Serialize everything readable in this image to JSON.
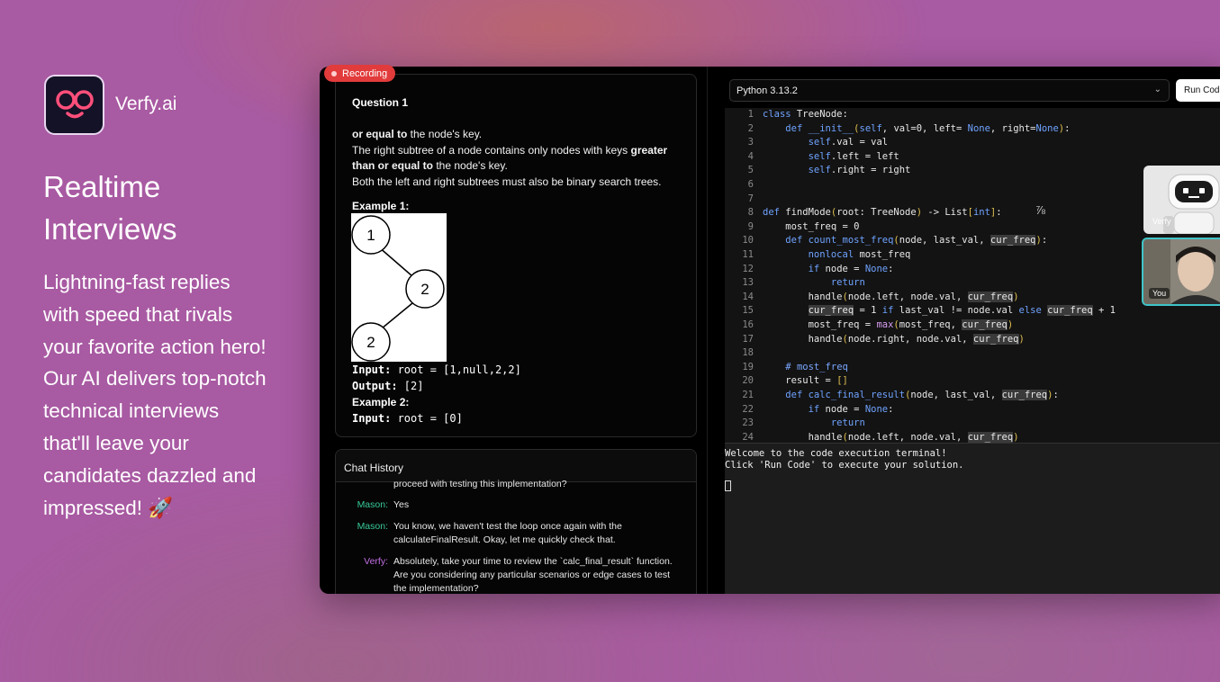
{
  "brand": {
    "name": "Verfy.ai"
  },
  "hero": {
    "headline_line1": "Realtime",
    "headline_line2": "Interviews",
    "tagline_lines": [
      "Lightning-fast replies",
      "with speed that rivals",
      "your favorite action hero!",
      "Our AI delivers top-notch",
      "technical interviews",
      "that'll leave your",
      "candidates dazzled and",
      "impressed! 🚀"
    ]
  },
  "recording": {
    "label": "Recording"
  },
  "question": {
    "title": "Question 1",
    "para_bold1": "or equal to",
    "para_text1": " the node's key.",
    "para_text2": "The right subtree of a node contains only nodes with keys ",
    "para_bold2": "greater than or equal to",
    "para_text3": " the node's key.",
    "para_text4": "Both the left and right subtrees must also be binary search trees.",
    "example1_label": "Example 1:",
    "tree_nodes": [
      "1",
      "2",
      "2"
    ],
    "input1_key": "Input:",
    "input1_value": " root = [1,null,2,2]",
    "output1_key": "Output:",
    "output1_value": " [2]",
    "example2_label": "Example 2:",
    "input2_key": "Input:",
    "input2_value": " root = [0]"
  },
  "chat": {
    "header": "Chat History",
    "partial_text": "proceed with testing this implementation?",
    "messages": [
      {
        "who": "Mason:",
        "text": "Yes"
      },
      {
        "who": "Mason:",
        "text": "You know, we haven't test the loop once again with the calculateFinalResult. Okay, let me quickly check that."
      },
      {
        "who": "Verfy:",
        "text": "Absolutely, take your time to review the `calc_final_result` function. Are you considering any particular scenarios or edge cases to test the implementation?"
      }
    ]
  },
  "editor": {
    "language": "Python 3.13.2",
    "run_label": "Run Code",
    "line_numbers": [
      "1",
      "2",
      "3",
      "4",
      "5",
      "6",
      "7",
      "8",
      "9",
      "10",
      "11",
      "12",
      "13",
      "14",
      "15",
      "16",
      "17",
      "18",
      "19",
      "20",
      "21",
      "22",
      "23",
      "24"
    ]
  },
  "terminal": {
    "line1": "Welcome to the code execution terminal!",
    "line2": "Click 'Run Code' to execute your solution."
  },
  "video": {
    "ai_label": "Verfy",
    "user_label": "You"
  },
  "colors": {
    "background": "#a85aa2",
    "accent_pink": "#ff4f7b",
    "recording_red": "#e23b3b",
    "mason_green": "#38c99a",
    "verfy_purple": "#c46ee6"
  }
}
